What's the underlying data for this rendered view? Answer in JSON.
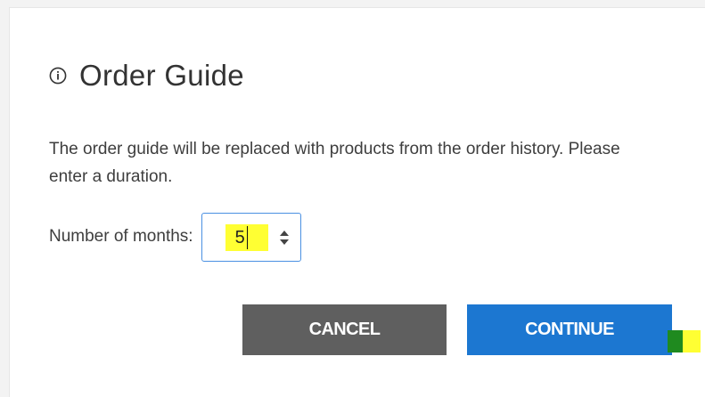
{
  "dialog": {
    "title": "Order Guide",
    "title_icon": "info-circle-icon",
    "description": "The order guide will be replaced with products from the order history. Please enter a duration.",
    "months_label": "Number of months:",
    "months_value": "5",
    "cancel_label": "CANCEL",
    "continue_label": "CONTINUE"
  },
  "colors": {
    "cancel_button": "#5f5f5f",
    "continue_button": "#1c77d1",
    "input_border": "#4a90e2",
    "highlight": "#ffff33",
    "marker_green": "#1f8a1f"
  }
}
